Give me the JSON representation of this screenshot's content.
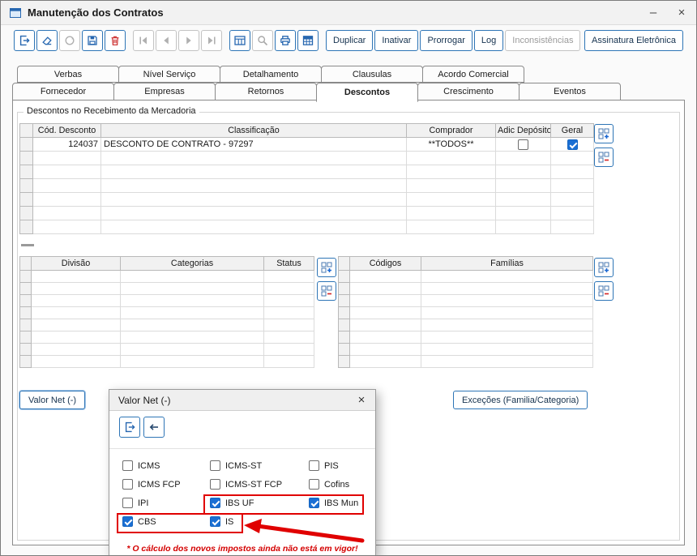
{
  "colors": {
    "accent": "#2e75b6",
    "checkbox_checked": "#1a6fd4",
    "danger": "#cf3a3a",
    "annotation_red": "#e00000",
    "disabled": "#c3c3c3"
  },
  "window": {
    "title": "Manutenção dos Contratos",
    "minimize_label": "–",
    "close_label": "×"
  },
  "toolbar": {
    "icon_buttons": [
      {
        "name": "exit",
        "icon": "door-exit-icon",
        "enabled": true
      },
      {
        "name": "clear",
        "icon": "eraser-icon",
        "enabled": true
      },
      {
        "name": "refresh",
        "icon": "circle-arrow-icon",
        "enabled": false
      },
      {
        "name": "save",
        "icon": "floppy-disk-icon",
        "enabled": true
      },
      {
        "name": "delete",
        "icon": "trash-icon",
        "enabled": true
      },
      {
        "name": "first-record",
        "icon": "first-record-icon",
        "enabled": false
      },
      {
        "name": "prior-record",
        "icon": "prior-record-icon",
        "enabled": false
      },
      {
        "name": "next-record",
        "icon": "next-record-icon",
        "enabled": false
      },
      {
        "name": "last-record",
        "icon": "last-record-icon",
        "enabled": false
      },
      {
        "name": "grid-view",
        "icon": "table-icon",
        "enabled": true
      },
      {
        "name": "search",
        "icon": "magnifier-icon",
        "enabled": false
      },
      {
        "name": "print",
        "icon": "printer-icon",
        "enabled": true
      },
      {
        "name": "schedule",
        "icon": "calendar-grid-icon",
        "enabled": true
      }
    ],
    "text_buttons": [
      {
        "label": "Duplicar",
        "enabled": true
      },
      {
        "label": "Inativar",
        "enabled": true
      },
      {
        "label": "Prorrogar",
        "enabled": true
      },
      {
        "label": "Log",
        "enabled": true
      },
      {
        "label": "Inconsistências",
        "enabled": false
      },
      {
        "label": "Assinatura Eletrônica",
        "enabled": true
      }
    ]
  },
  "tabs": {
    "row1": [
      {
        "label": "Verbas"
      },
      {
        "label": "Nível Serviço"
      },
      {
        "label": "Detalhamento"
      },
      {
        "label": "Clausulas"
      },
      {
        "label": "Acordo Comercial"
      }
    ],
    "row2": [
      {
        "label": "Fornecedor"
      },
      {
        "label": "Empresas"
      },
      {
        "label": "Retornos"
      },
      {
        "label": "Descontos",
        "active": true
      },
      {
        "label": "Crescimento"
      },
      {
        "label": "Eventos"
      }
    ],
    "active_tab": "Descontos"
  },
  "content": {
    "group_title": "Descontos no Recebimento da Mercadoria",
    "grid_buttons": {
      "add_icon": "grid-add-icon",
      "remove_icon": "grid-remove-icon"
    },
    "main_table": {
      "headers": [
        "Cód. Desconto",
        "Classificação",
        "Comprador",
        "Adic Depósito",
        "Geral"
      ],
      "rows": [
        {
          "cod_desconto": "124037",
          "classificacao": "DESCONTO DE CONTRATO - 97297",
          "comprador": "**TODOS**",
          "adic_deposito": false,
          "geral": true
        }
      ]
    },
    "division_table": {
      "headers": [
        "Divisão",
        "Categorias",
        "Status"
      ]
    },
    "family_table": {
      "headers": [
        "Códigos",
        "Famílias"
      ]
    },
    "valor_net_button": "Valor Net (-)",
    "excecoes_button": "Exceções (Familia/Categoria)"
  },
  "dialog": {
    "title": "Valor Net (-)",
    "close_label": "×",
    "toolbar_buttons": [
      {
        "name": "exit",
        "icon": "door-exit-icon",
        "enabled": true
      },
      {
        "name": "back",
        "icon": "arrow-left-icon",
        "enabled": true
      }
    ],
    "checkboxes": [
      {
        "label": "ICMS",
        "checked": false
      },
      {
        "label": "ICMS-ST",
        "checked": false
      },
      {
        "label": "PIS",
        "checked": false
      },
      {
        "label": "ICMS FCP",
        "checked": false
      },
      {
        "label": "ICMS-ST FCP",
        "checked": false
      },
      {
        "label": "Cofins",
        "checked": false
      },
      {
        "label": "IPI",
        "checked": false
      },
      {
        "label": "IBS UF",
        "checked": true
      },
      {
        "label": "IBS Mun",
        "checked": true
      },
      {
        "label": "CBS",
        "checked": true
      },
      {
        "label": "IS",
        "checked": true
      }
    ],
    "footnote": "* O cálculo dos novos impostos ainda não está em vigor!"
  }
}
